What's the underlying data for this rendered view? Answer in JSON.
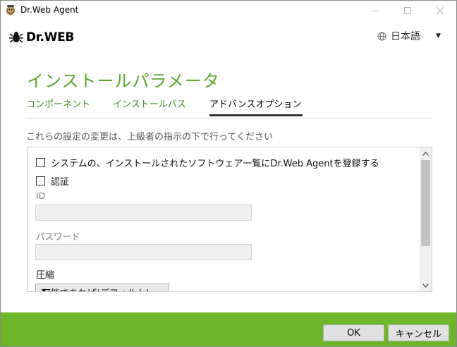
{
  "window": {
    "title": "Dr.Web Agent",
    "minimize_icon": "minimize-icon",
    "maximize_icon": "maximize-icon",
    "close_icon": "close-icon"
  },
  "header": {
    "logo_text": "Dr.WEB",
    "language": "日本語"
  },
  "page": {
    "title": "インストールパラメータ",
    "description": "これらの設定の変更は、上級者の指示の下で行ってください"
  },
  "tabs": [
    {
      "label": "コンポーネント",
      "active": false
    },
    {
      "label": "インストールパス",
      "active": false
    },
    {
      "label": "アドバンスオプション",
      "active": true
    }
  ],
  "options": {
    "register_label": "システムの、インストールされたソフトウェア一覧にDr.Web Agentを登録する",
    "auth_label": "認証",
    "id_label": "ID",
    "id_value": "",
    "password_label": "パスワード",
    "password_value": "",
    "compression_label": "圧縮",
    "compression_selected": "可能であれば(デフォルト)"
  },
  "footer": {
    "ok_label": "OK",
    "cancel_label": "キャンセル"
  },
  "colors": {
    "accent": "#5aa62c",
    "footer": "#6eb52a"
  }
}
